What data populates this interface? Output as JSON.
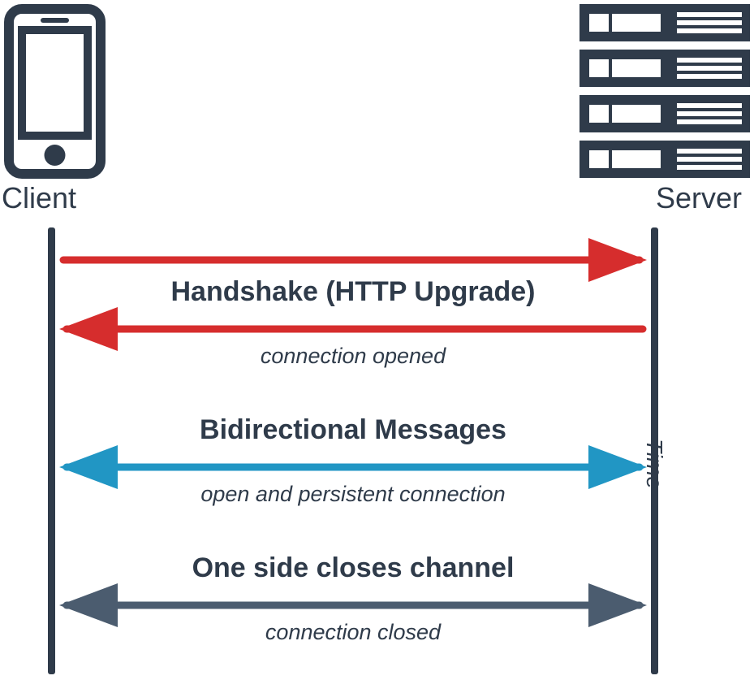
{
  "client_label": "Client",
  "server_label": "Server",
  "time_label": "Time",
  "handshake": {
    "title": "Handshake (HTTP Upgrade)",
    "sub": "connection opened"
  },
  "bidir": {
    "title": "Bidirectional Messages",
    "sub": "open and persistent connection"
  },
  "close": {
    "title": "One side closes channel",
    "sub": "connection closed"
  },
  "colors": {
    "dark": "#2f3b4a",
    "red": "#d62d2d",
    "blue": "#2196c4",
    "slate": "#4b5c6f"
  }
}
